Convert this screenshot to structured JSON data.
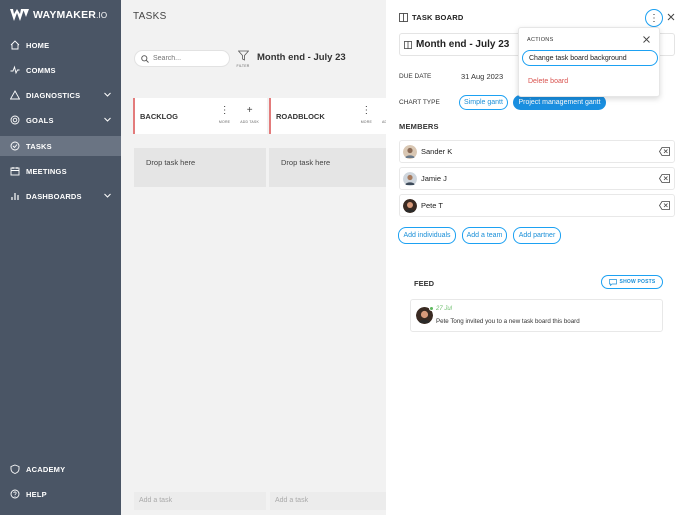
{
  "brand": {
    "name": "WAYMAKER",
    "suffix": ".IO"
  },
  "sidebar": {
    "items": [
      {
        "label": "HOME",
        "icon": "home-icon"
      },
      {
        "label": "COMMS",
        "icon": "pulse-icon"
      },
      {
        "label": "DIAGNOSTICS",
        "icon": "triangle-icon"
      },
      {
        "label": "GOALS",
        "icon": "target-icon"
      },
      {
        "label": "TASKS",
        "icon": "check-circle-icon"
      },
      {
        "label": "MEETINGS",
        "icon": "calendar-icon"
      },
      {
        "label": "DASHBOARDS",
        "icon": "bar-chart-icon"
      }
    ],
    "bottom": [
      {
        "label": "ACADEMY",
        "icon": "shield-icon"
      },
      {
        "label": "HELP",
        "icon": "help-icon"
      }
    ],
    "active_item": "TASKS"
  },
  "main": {
    "title": "TASKS",
    "search_placeholder": "Search...",
    "filter_label": "FILTER",
    "board_title": "Month end - July 23",
    "columns": [
      {
        "name": "BACKLOG",
        "more_label": "MORE",
        "add_label": "ADD TASK",
        "drop_text": "Drop task here",
        "add_task_placeholder": "Add a task"
      },
      {
        "name": "ROADBLOCK",
        "more_label": "MORE",
        "add_label": "ADD",
        "drop_text": "Drop task here",
        "add_task_placeholder": "Add a task"
      }
    ]
  },
  "panel": {
    "title": "TASK BOARD",
    "board_name": "Month end - July 23",
    "due_date_label": "DUE DATE",
    "due_date_value": "31 Aug 2023",
    "chart_type_label": "CHART TYPE",
    "chart_types": [
      {
        "label": "Simple gantt",
        "selected": false
      },
      {
        "label": "Project management gantt",
        "selected": true
      }
    ],
    "members_label": "MEMBERS",
    "members": [
      {
        "name": "Sander K"
      },
      {
        "name": "Jamie J"
      },
      {
        "name": "Pete T"
      }
    ],
    "add_buttons": [
      "Add individuals",
      "Add a team",
      "Add partner"
    ],
    "feed_label": "FEED",
    "show_posts_label": "SHOW POSTS",
    "feed_items": [
      {
        "date": "27 Jul",
        "message": "Pete Tong invited you to a new task board this board"
      }
    ]
  },
  "actions_menu": {
    "header": "ACTIONS",
    "options": [
      {
        "label": "Change task board background",
        "highlighted": true
      },
      {
        "label": "Delete board",
        "danger": true
      }
    ]
  },
  "colors": {
    "sidebar_bg": "#4a5565",
    "sidebar_active": "#6a7483",
    "accent": "#1da1f2",
    "danger": "#d9534f",
    "column_border": "#e37b7b"
  }
}
